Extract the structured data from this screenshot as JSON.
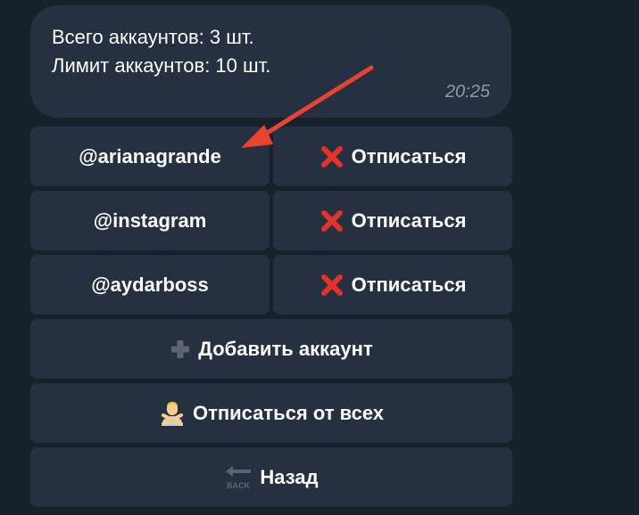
{
  "message": {
    "total_line": "Всего аккаунтов: 3 шт.",
    "limit_line": "Лимит аккаунтов: 10 шт.",
    "time": "20:25"
  },
  "accounts": [
    {
      "handle": "@arianagrande",
      "action": "Отписаться"
    },
    {
      "handle": "@instagram",
      "action": "Отписаться"
    },
    {
      "handle": "@aydarboss",
      "action": "Отписаться"
    }
  ],
  "buttons": {
    "add_account": "Добавить аккаунт",
    "unsubscribe_all": "Отписаться от всех",
    "back": "Назад",
    "back_icon_text": "BACK"
  },
  "icons": {
    "unsubscribe": "cross-mark-icon",
    "add": "plus-icon",
    "unsubscribe_all": "gesture-no-icon",
    "back": "back-arrow-icon"
  },
  "colors": {
    "background": "#17212b",
    "bubble": "#253141",
    "cross": "#e2322a",
    "annotation_arrow": "#e8432e",
    "time": "#8b9aab"
  }
}
